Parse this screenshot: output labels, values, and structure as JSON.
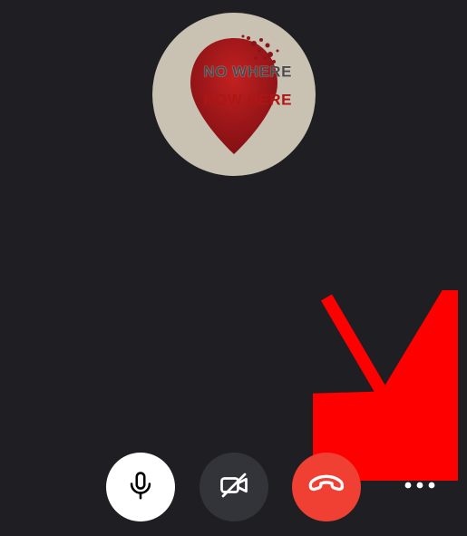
{
  "avatar": {
    "line1": "NO WHERE",
    "line2": "NOW HERE"
  },
  "icons": {
    "heart": "heart-icon",
    "mic": "microphone-icon",
    "video_off": "video-off-icon",
    "hangup": "phone-hangup-icon",
    "more": "more-options-icon"
  },
  "colors": {
    "bg": "#1f1f23",
    "mic_btn": "#ffffff",
    "video_btn": "#33333a",
    "hangup_btn": "#f04034",
    "annotation_arrow": "#ff0000",
    "avatar_bg": "#c9c1b2",
    "avatar_pin": "#a3151b"
  },
  "annotation": {
    "points_to": "more-options-button"
  }
}
